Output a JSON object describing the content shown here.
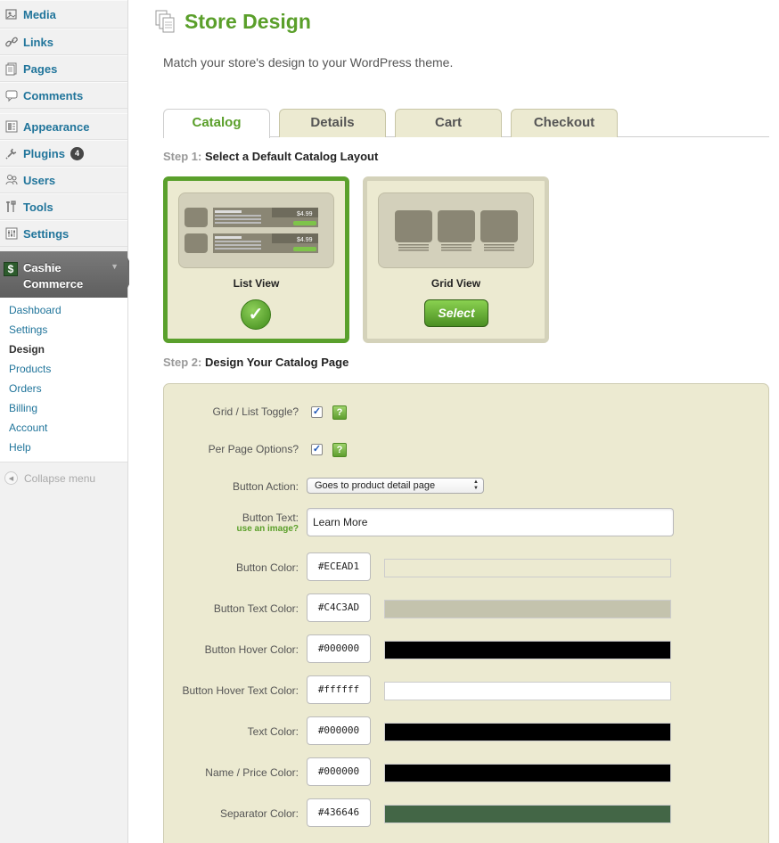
{
  "sidebar": {
    "items": [
      {
        "label": "Media",
        "icon": "media-icon"
      },
      {
        "label": "Links",
        "icon": "link-icon"
      },
      {
        "label": "Pages",
        "icon": "pages-icon"
      },
      {
        "label": "Comments",
        "icon": "comments-icon"
      },
      {
        "label": "Appearance",
        "icon": "appearance-icon"
      },
      {
        "label": "Plugins",
        "icon": "plugins-icon",
        "badge": "4"
      },
      {
        "label": "Users",
        "icon": "users-icon"
      },
      {
        "label": "Tools",
        "icon": "tools-icon"
      },
      {
        "label": "Settings",
        "icon": "settings-icon"
      }
    ],
    "cashie": {
      "line1": "Cashie",
      "line2": "Commerce",
      "icon": "$"
    },
    "submenu": [
      "Dashboard",
      "Settings",
      "Design",
      "Products",
      "Orders",
      "Billing",
      "Account",
      "Help"
    ],
    "current_submenu": "Design",
    "collapse_label": "Collapse menu"
  },
  "header": {
    "title": "Store Design",
    "description": "Match your store's design to your WordPress theme."
  },
  "tabs": [
    {
      "label": "Catalog",
      "active": true
    },
    {
      "label": "Details",
      "active": false
    },
    {
      "label": "Cart",
      "active": false
    },
    {
      "label": "Checkout",
      "active": false
    }
  ],
  "step1": {
    "prefix": "Step 1:",
    "text": "Select a Default Catalog Layout"
  },
  "layouts": {
    "list": {
      "label": "List View",
      "selected": true,
      "price_tag": "$4.99"
    },
    "grid": {
      "label": "Grid View",
      "selected": false,
      "select_label": "Select"
    }
  },
  "step2": {
    "prefix": "Step 2:",
    "text": "Design Your Catalog Page"
  },
  "form": {
    "grid_toggle": {
      "label": "Grid / List Toggle?",
      "checked": true,
      "help": "?"
    },
    "per_page": {
      "label": "Per Page Options?",
      "checked": true,
      "help": "?"
    },
    "button_action": {
      "label": "Button Action:",
      "value": "Goes to product detail page"
    },
    "button_text": {
      "label": "Button Text:",
      "sub_link": "use an image?",
      "value": "Learn More"
    },
    "colors": [
      {
        "label": "Button Color:",
        "value": "#ECEAD1",
        "swatch": "#ECEAD1"
      },
      {
        "label": "Button Text Color:",
        "value": "#C4C3AD",
        "swatch": "#C4C3AD"
      },
      {
        "label": "Button Hover Color:",
        "value": "#000000",
        "swatch": "#000000"
      },
      {
        "label": "Button Hover Text Color:",
        "value": "#ffffff",
        "swatch": "#ffffff"
      },
      {
        "label": "Text Color:",
        "value": "#000000",
        "swatch": "#000000"
      },
      {
        "label": "Name / Price Color:",
        "value": "#000000",
        "swatch": "#000000"
      },
      {
        "label": "Separator Color:",
        "value": "#436646",
        "swatch": "#436646"
      }
    ]
  },
  "colors": {
    "accent_green": "#5a9f2a",
    "link_blue": "#21759b",
    "panel_bg": "#ecead1"
  }
}
